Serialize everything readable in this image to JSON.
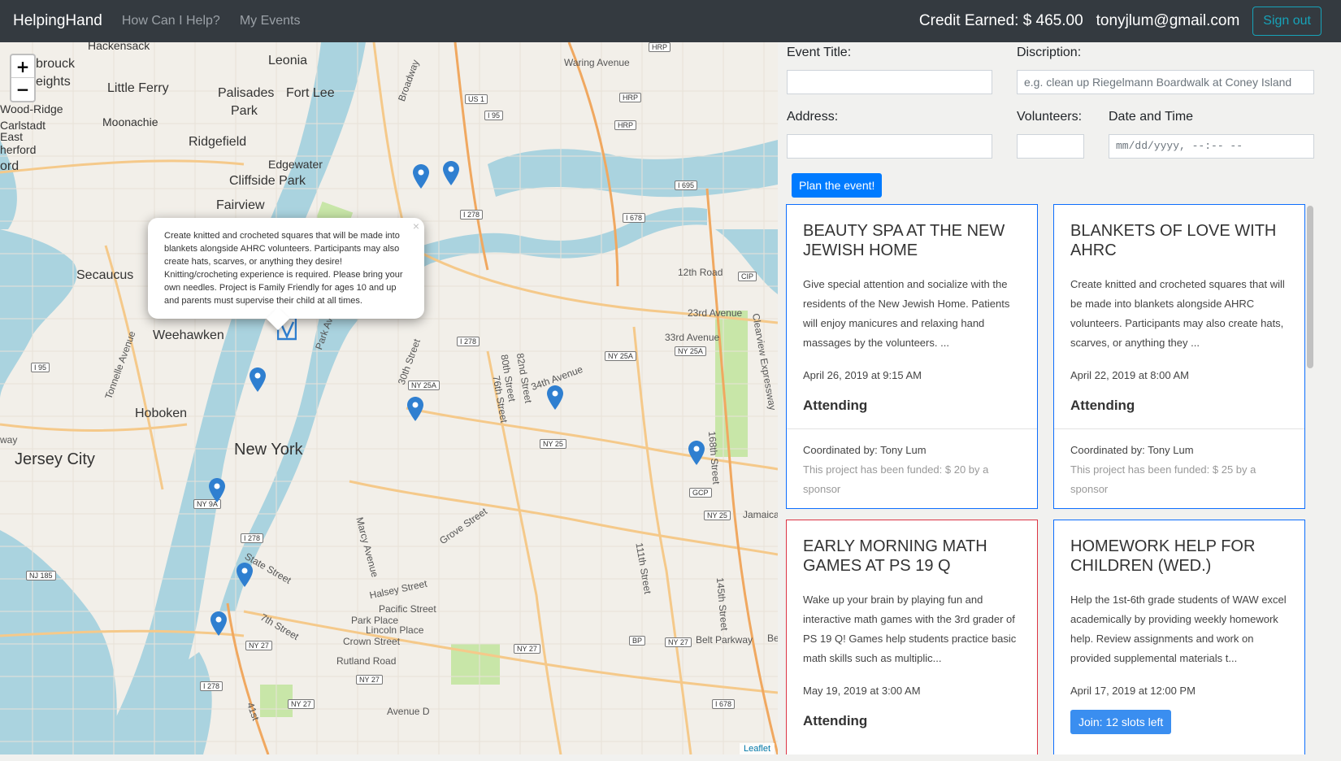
{
  "navbar": {
    "brand": "HelpingHand",
    "links": [
      "How Can I Help?",
      "My Events"
    ],
    "credit": "Credit Earned: $ 465.00",
    "email": "tonyjlum@gmail.com",
    "signout": "Sign out"
  },
  "map": {
    "zoom_in": "+",
    "zoom_out": "−",
    "attribution": "Leaflet",
    "labels": {
      "hackensack": "Hackensack",
      "leonia": "Leonia",
      "brouck": "brouck",
      "eights": "eights",
      "little_ferry": "Little Ferry",
      "palisades_park": "Palisades",
      "park": "Park",
      "fort_lee": "Fort Lee",
      "wood_ridge": "Wood-Ridge",
      "carlstadt": "Carlstadt",
      "east": "East",
      "herford": "herford",
      "ord": "ord",
      "moonachie": "Moonachie",
      "ridgefield": "Ridgefield",
      "edgewater": "Edgewater",
      "cliffside_park": "Cliffside Park",
      "fairview": "Fairview",
      "secaucus": "Secaucus",
      "weehawken": "Weehawken",
      "hoboken": "Hoboken",
      "way": "way",
      "jersey_city": "Jersey City",
      "new_york": "New York",
      "waring_avenue": "Waring Avenue",
      "broadway": "Broadway",
      "twelfth_road": "12th Road",
      "twentythird_ave": "23rd Avenue",
      "thirtythird_ave": "33rd Avenue",
      "thirtyfourth_ave": "34th Avenue",
      "thirtieth_st": "30th Street",
      "eightieth": "80th Street",
      "eightysecond": "82nd Street",
      "seventysixth": "76th Street",
      "park_ave": "Park Ave",
      "grove_street": "Grove Street",
      "halsey_street": "Halsey Street",
      "pacific_street": "Pacific Street",
      "park_place": "Park Place",
      "lincoln_place": "Lincoln Place",
      "crown_street": "Crown Street",
      "rutland_road": "Rutland Road",
      "state_street": "State Street",
      "seventh_street": "7th Street",
      "marcy_ave": "Marcy Avenue",
      "tonnelle": "Tonnelle Avenue",
      "jamaica": "Jamaica",
      "belt_parkway": "Belt Parkway",
      "cleariew": "Clearview Expressway",
      "onesixtyeighth": "168th Street",
      "onefortyfifth": "145th Street",
      "oneeleventh": "111th Street",
      "avenue_d": "Avenue D",
      "fortyfirst": "41st",
      "be": "Be"
    },
    "shields": {
      "us1": "US 1",
      "i95a": "I 95",
      "hrp1": "HRP",
      "hrp2": "HRP",
      "hrp3": "HRP",
      "i695": "I 695",
      "i278a": "I 278",
      "i678a": "I 678",
      "cip": "CIP",
      "i278b": "I 278",
      "ny25a1": "NY 25A",
      "ny25a2": "NY 25A",
      "ny25a3": "NY 25A",
      "i95b": "I 95",
      "ny25a": "NY 25",
      "gcp": "GCP",
      "ny25b": "NY 25",
      "ny9a": "NY 9A",
      "i278c": "I 278",
      "nj185": "NJ 185",
      "ny27a": "NY 27",
      "ny27b": "NY 27",
      "ny27c": "NY 27",
      "ny27d": "NY 27",
      "bp": "BP",
      "i278d": "I 278",
      "ny27e": "NY 27",
      "i678b": "I 678"
    },
    "popup": {
      "close": "×",
      "text": "Create knitted and crocheted squares that will be made into blankets alongside AHRC volunteers. Participants may also create hats, scarves, or anything they desire! Knitting/crocheting experience is required. Please bring your own needles. Project is Family Friendly for ages 10 and up and parents must supervise their child at all times."
    }
  },
  "form": {
    "event_title_label": "Event Title:",
    "description_label": "Discription:",
    "description_placeholder": "e.g. clean up Riegelmann Boardwalk at Coney Island",
    "address_label": "Address:",
    "volunteers_label": "Volunteers:",
    "datetime_label": "Date and Time",
    "datetime_placeholder": "mm/dd/yyyy, --:-- --",
    "plan_button": "Plan the event!"
  },
  "cards": [
    {
      "title": "Beauty Spa at the New Jewish Home",
      "text": "Give special attention and socialize with the residents of the New Jewish Home. Patients will enjoy manicures and relaxing hand massages by the volunteers. ...",
      "date": "April 26, 2019 at 9:15 AM",
      "status": "Attending",
      "coordinator": "Coordinated by: Tony Lum",
      "funded": "This project has been funded: $ 20 by a sponsor"
    },
    {
      "title": "Blankets of Love with AHRC",
      "text": "Create knitted and crocheted squares that will be made into blankets alongside AHRC volunteers. Participants may also create hats, scarves, or anything they ...",
      "date": "April 22, 2019 at 8:00 AM",
      "status": "Attending",
      "coordinator": "Coordinated by: Tony Lum",
      "funded": "This project has been funded: $ 25 by a sponsor"
    },
    {
      "title": "Early Morning Math Games at PS 19 Q",
      "text": "Wake up your brain by playing fun and interactive math games with the 3rd grader of PS 19 Q! Games help students practice basic math skills such as multiplic...",
      "date": "May 19, 2019 at 3:00 AM",
      "status": "Attending"
    },
    {
      "title": "Homework Help for Children (Wed.)",
      "text": "Help the 1st-6th grade students of WAW excel academically by providing weekly homework help. Review assignments and work on provided supplemental materials t...",
      "date": "April 17, 2019 at 12:00 PM",
      "join": "Join: 12 slots left"
    }
  ],
  "colors": {
    "navbar": "#343a40",
    "primary": "#007bff",
    "info": "#17a2b8",
    "danger": "#dc3545",
    "marker": "#2f7fd0"
  }
}
